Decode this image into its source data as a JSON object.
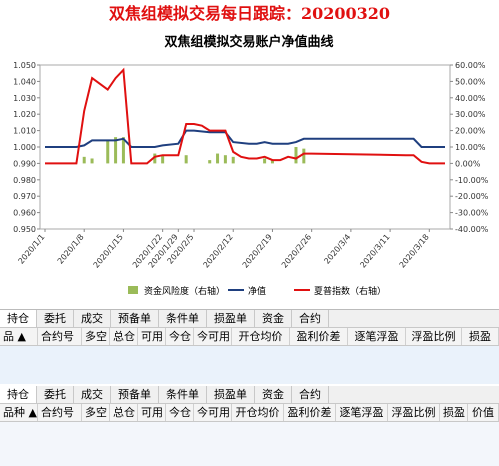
{
  "banner": {
    "title": "双焦组模拟交易每日跟踪：20200320"
  },
  "chart_data": {
    "type": "combo",
    "title": "双焦组模拟交易账户净值曲线",
    "x_dates": [
      "2020/1/1",
      "2020/1/2",
      "2020/1/3",
      "2020/1/6",
      "2020/1/7",
      "2020/1/8",
      "2020/1/9",
      "2020/1/10",
      "2020/1/13",
      "2020/1/14",
      "2020/1/15",
      "2020/1/16",
      "2020/1/17",
      "2020/1/20",
      "2020/1/21",
      "2020/1/22",
      "2020/1/23",
      "2020/2/3",
      "2020/2/4",
      "2020/2/5",
      "2020/2/6",
      "2020/2/7",
      "2020/2/10",
      "2020/2/11",
      "2020/2/12",
      "2020/2/13",
      "2020/2/14",
      "2020/2/17",
      "2020/2/18",
      "2020/2/19",
      "2020/2/20",
      "2020/2/21",
      "2020/2/24",
      "2020/2/25",
      "2020/2/26",
      "2020/2/27",
      "2020/2/28",
      "2020/3/2",
      "2020/3/3",
      "2020/3/4",
      "2020/3/5",
      "2020/3/6",
      "2020/3/9",
      "2020/3/10",
      "2020/3/11",
      "2020/3/12",
      "2020/3/13",
      "2020/3/16",
      "2020/3/17",
      "2020/3/18",
      "2020/3/19",
      "2020/3/20"
    ],
    "x_tick_labels": [
      "2020/1/1",
      "2020/1/8",
      "2020/1/15",
      "2020/1/22",
      "2020/1/29",
      "2020/2/5",
      "2020/2/12",
      "2020/2/19",
      "2020/2/26",
      "2020/3/4",
      "2020/3/11",
      "2020/3/18"
    ],
    "y_left": {
      "min": 0.95,
      "max": 1.05,
      "step": 0.01,
      "ticks": [
        "1.050",
        "1.040",
        "1.030",
        "1.020",
        "1.010",
        "1.000",
        "0.990",
        "0.980",
        "0.970",
        "0.960",
        "0.950"
      ]
    },
    "y_right": {
      "min": -40,
      "max": 60,
      "step": 10,
      "ticks": [
        "60.00%",
        "50.00%",
        "40.00%",
        "30.00%",
        "20.00%",
        "10.00%",
        "0.00%",
        "-10.00%",
        "-20.00%",
        "-30.00%",
        "-40.00%"
      ]
    },
    "series": [
      {
        "name": "资金风险度（右轴）",
        "type": "bar",
        "axis": "right",
        "color": "#9bbb59",
        "points": [
          [
            "2020/1/8",
            4
          ],
          [
            "2020/1/9",
            3
          ],
          [
            "2020/1/13",
            14
          ],
          [
            "2020/1/14",
            16
          ],
          [
            "2020/1/15",
            16
          ],
          [
            "2020/1/21",
            6
          ],
          [
            "2020/1/22",
            5
          ],
          [
            "2020/2/4",
            5
          ],
          [
            "2020/2/7",
            2
          ],
          [
            "2020/2/10",
            6
          ],
          [
            "2020/2/11",
            5
          ],
          [
            "2020/2/12",
            4
          ],
          [
            "2020/2/18",
            3
          ],
          [
            "2020/2/19",
            2
          ],
          [
            "2020/2/24",
            10
          ],
          [
            "2020/2/25",
            9
          ]
        ]
      },
      {
        "name": "净值",
        "type": "line",
        "axis": "left",
        "color": "#1f3f7f",
        "points": [
          [
            "2020/1/1",
            1.0
          ],
          [
            "2020/1/2",
            1.0
          ],
          [
            "2020/1/3",
            1.0
          ],
          [
            "2020/1/6",
            1.0
          ],
          [
            "2020/1/7",
            1.0
          ],
          [
            "2020/1/8",
            1.001
          ],
          [
            "2020/1/9",
            1.004
          ],
          [
            "2020/1/13",
            1.004
          ],
          [
            "2020/1/14",
            1.004
          ],
          [
            "2020/1/15",
            1.005
          ],
          [
            "2020/1/16",
            1.0
          ],
          [
            "2020/1/20",
            1.0
          ],
          [
            "2020/1/21",
            1.0
          ],
          [
            "2020/1/22",
            1.001
          ],
          [
            "2020/2/3",
            1.002
          ],
          [
            "2020/2/4",
            1.01
          ],
          [
            "2020/2/5",
            1.01
          ],
          [
            "2020/2/7",
            1.009
          ],
          [
            "2020/2/10",
            1.009
          ],
          [
            "2020/2/11",
            1.009
          ],
          [
            "2020/2/12",
            1.003
          ],
          [
            "2020/2/14",
            1.002
          ],
          [
            "2020/2/17",
            1.002
          ],
          [
            "2020/2/18",
            1.003
          ],
          [
            "2020/2/19",
            1.002
          ],
          [
            "2020/2/20",
            1.002
          ],
          [
            "2020/2/21",
            1.002
          ],
          [
            "2020/2/24",
            1.003
          ],
          [
            "2020/2/25",
            1.005
          ],
          [
            "2020/2/26",
            1.005
          ],
          [
            "2020/3/13",
            1.005
          ],
          [
            "2020/3/16",
            1.005
          ],
          [
            "2020/3/17",
            1.0
          ],
          [
            "2020/3/20",
            1.0
          ]
        ]
      },
      {
        "name": "夏普指数（右轴）",
        "type": "line",
        "axis": "right",
        "color": "#e01010",
        "points": [
          [
            "2020/1/1",
            0
          ],
          [
            "2020/1/2",
            0
          ],
          [
            "2020/1/3",
            0
          ],
          [
            "2020/1/6",
            0
          ],
          [
            "2020/1/7",
            0
          ],
          [
            "2020/1/8",
            32
          ],
          [
            "2020/1/9",
            52
          ],
          [
            "2020/1/13",
            45
          ],
          [
            "2020/1/14",
            52
          ],
          [
            "2020/1/15",
            57
          ],
          [
            "2020/1/16",
            0
          ],
          [
            "2020/1/17",
            0
          ],
          [
            "2020/1/20",
            0
          ],
          [
            "2020/1/21",
            4
          ],
          [
            "2020/1/22",
            5
          ],
          [
            "2020/1/23",
            5
          ],
          [
            "2020/2/3",
            5
          ],
          [
            "2020/2/4",
            24
          ],
          [
            "2020/2/5",
            24
          ],
          [
            "2020/2/6",
            23
          ],
          [
            "2020/2/7",
            20
          ],
          [
            "2020/2/10",
            20
          ],
          [
            "2020/2/11",
            20
          ],
          [
            "2020/2/12",
            7
          ],
          [
            "2020/2/13",
            4
          ],
          [
            "2020/2/14",
            3
          ],
          [
            "2020/2/17",
            3
          ],
          [
            "2020/2/18",
            4
          ],
          [
            "2020/2/19",
            2
          ],
          [
            "2020/2/20",
            2
          ],
          [
            "2020/2/21",
            4
          ],
          [
            "2020/2/24",
            3
          ],
          [
            "2020/2/25",
            6
          ],
          [
            "2020/2/26",
            6
          ],
          [
            "2020/3/13",
            5
          ],
          [
            "2020/3/16",
            5
          ],
          [
            "2020/3/17",
            1
          ],
          [
            "2020/3/18",
            0
          ],
          [
            "2020/3/19",
            0
          ],
          [
            "2020/3/20",
            0
          ]
        ]
      }
    ],
    "legend_position": "bottom",
    "grid": false
  },
  "panel1": {
    "tabs": [
      "持仓",
      "委托",
      "成交",
      "预备单",
      "条件单",
      "损盈单",
      "资金",
      "合约"
    ],
    "columns": [
      "品 ▲",
      "合约号",
      "多空",
      "总仓",
      "可用",
      "今仓",
      "今可用",
      "开仓均价",
      "盈利价差",
      "逐笔浮盈",
      "浮盈比例",
      "损盈"
    ]
  },
  "panel2": {
    "tabs": [
      "持仓",
      "委托",
      "成交",
      "预备单",
      "条件单",
      "损盈单",
      "资金",
      "合约"
    ],
    "columns": [
      "品种 ▲",
      "合约号",
      "多空",
      "总仓",
      "可用",
      "今仓",
      "今可用",
      "开仓均价",
      "盈利价差",
      "逐笔浮盈",
      "浮盈比例",
      "损盈",
      "价值"
    ]
  }
}
